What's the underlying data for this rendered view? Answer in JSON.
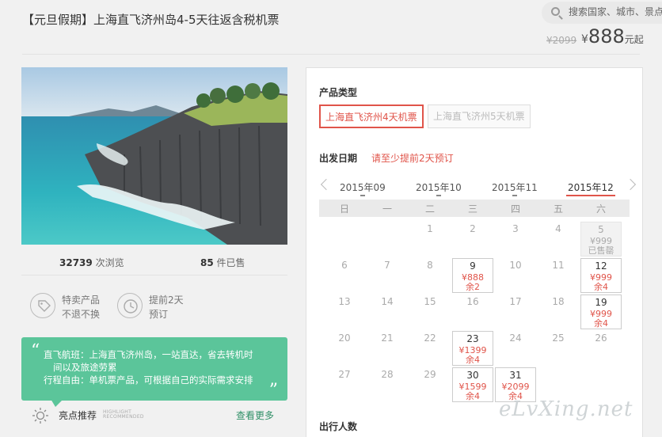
{
  "header": {
    "title": "【元旦假期】上海直飞济州岛4-5天往返含税机票",
    "search_placeholder": "搜索国家、城市、景点"
  },
  "price": {
    "original": "¥2099",
    "currency": "¥",
    "current": "888",
    "suffix": "元起"
  },
  "stats": {
    "views": "32739",
    "views_label": "次浏览",
    "sold": "85",
    "sold_label": "件已售"
  },
  "features": [
    {
      "line1": "特卖产品",
      "line2": "不退不换",
      "icon": "tag-icon"
    },
    {
      "line1": "提前2天",
      "line2": "预订",
      "icon": "clock-icon"
    }
  ],
  "note": {
    "line1": "直飞航班：上海直飞济州岛，一站直达，省去转机时",
    "line2": "间以及旅途劳累",
    "line3": "行程自由：单机票产品，可根据自己的实际需求安排"
  },
  "highlights": {
    "label": "亮点推荐",
    "en_line1": "HIGHLIGHT",
    "en_line2": "RECOMMENDED",
    "more": "查看更多"
  },
  "product_type": {
    "section_label": "产品类型",
    "options": [
      "上海直飞济州4天机票",
      "上海直飞济州5天机票"
    ],
    "selected_index": 0
  },
  "departure": {
    "section_label": "出发日期",
    "hint": "请至少提前2天预订",
    "months": [
      "2015年09",
      "2015年10",
      "2015年11",
      "2015年12"
    ],
    "active_month_index": 3,
    "weekdays": [
      "日",
      "一",
      "二",
      "三",
      "四",
      "五",
      "六"
    ],
    "weeks": [
      [
        null,
        null,
        {
          "day": "1"
        },
        {
          "day": "2"
        },
        {
          "day": "3"
        },
        {
          "day": "4"
        },
        {
          "day": "5",
          "price": "¥999",
          "status": "已售罄",
          "state": "soldout"
        }
      ],
      [
        {
          "day": "6"
        },
        {
          "day": "7"
        },
        {
          "day": "8"
        },
        {
          "day": "9",
          "price": "¥888",
          "status": "余2",
          "state": "avail"
        },
        {
          "day": "10"
        },
        {
          "day": "11"
        },
        {
          "day": "12",
          "price": "¥999",
          "status": "余4",
          "state": "avail"
        }
      ],
      [
        {
          "day": "13"
        },
        {
          "day": "14"
        },
        {
          "day": "15"
        },
        {
          "day": "16"
        },
        {
          "day": "17"
        },
        {
          "day": "18"
        },
        {
          "day": "19",
          "price": "¥999",
          "status": "余4",
          "state": "avail"
        }
      ],
      [
        {
          "day": "20"
        },
        {
          "day": "21"
        },
        {
          "day": "22"
        },
        {
          "day": "23",
          "price": "¥1399",
          "status": "余4",
          "state": "avail"
        },
        {
          "day": "24"
        },
        {
          "day": "25"
        },
        {
          "day": "26"
        }
      ],
      [
        {
          "day": "27"
        },
        {
          "day": "28"
        },
        {
          "day": "29"
        },
        {
          "day": "30",
          "price": "¥1599",
          "status": "余4",
          "state": "avail"
        },
        {
          "day": "31",
          "price": "¥2099",
          "status": "余4",
          "state": "avail"
        },
        null,
        null
      ]
    ]
  },
  "travelers": {
    "section_label": "出行人数"
  },
  "watermark": "eLvXing.net"
}
